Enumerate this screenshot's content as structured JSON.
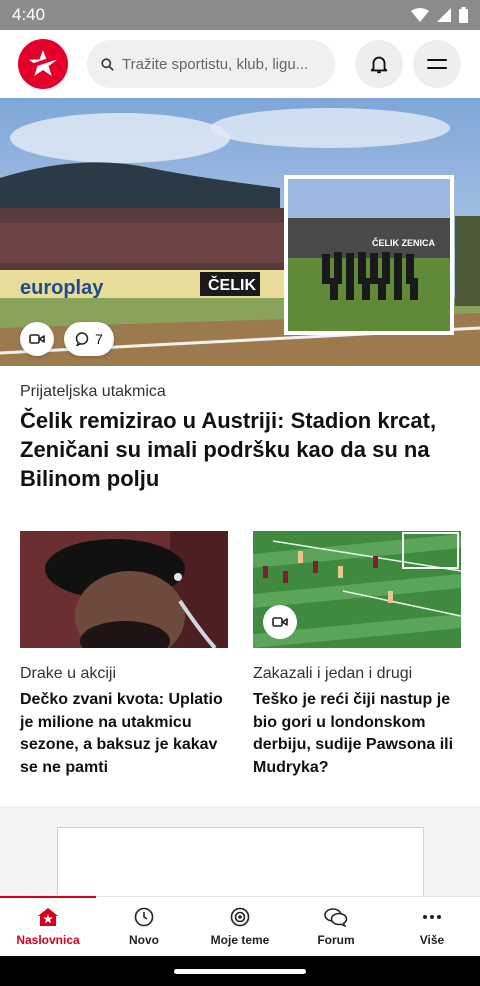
{
  "status_bar": {
    "time": "4:40"
  },
  "header": {
    "search_placeholder": "Tražite sportistu, klub, ligu...",
    "brand_color": "#e4002b"
  },
  "hero": {
    "category": "Prijateljska utakmica",
    "title": "Čelik remizirao u Austriji: Stadion krcat, Zeničani su imali podršku kao da su na Bilinom polju",
    "comments_count": "7",
    "banner_text_1": "europlay",
    "banner_text_2": "ČELIK",
    "banner_text_3": "ČELIK ZENICA"
  },
  "cards": [
    {
      "category": "Drake u akciji",
      "title": "Dečko zvani kvota: Uplatio je milione na utakmicu sezone, a baksuz je kakav se ne pamti"
    },
    {
      "category": "Zakazali i jedan i drugi",
      "title": "Teško je reći čiji nastup je bio gori u londonskom derbiju, sudije Pawsona ili Mudryka?"
    }
  ],
  "bottom_nav": [
    {
      "label": "Naslovnica",
      "icon": "home-icon",
      "active": true
    },
    {
      "label": "Novo",
      "icon": "clock-icon"
    },
    {
      "label": "Moje teme",
      "icon": "target-icon"
    },
    {
      "label": "Forum",
      "icon": "chat-bubbles-icon"
    },
    {
      "label": "Više",
      "icon": "more-dots-icon"
    }
  ],
  "colors": {
    "accent": "#d6001c"
  }
}
